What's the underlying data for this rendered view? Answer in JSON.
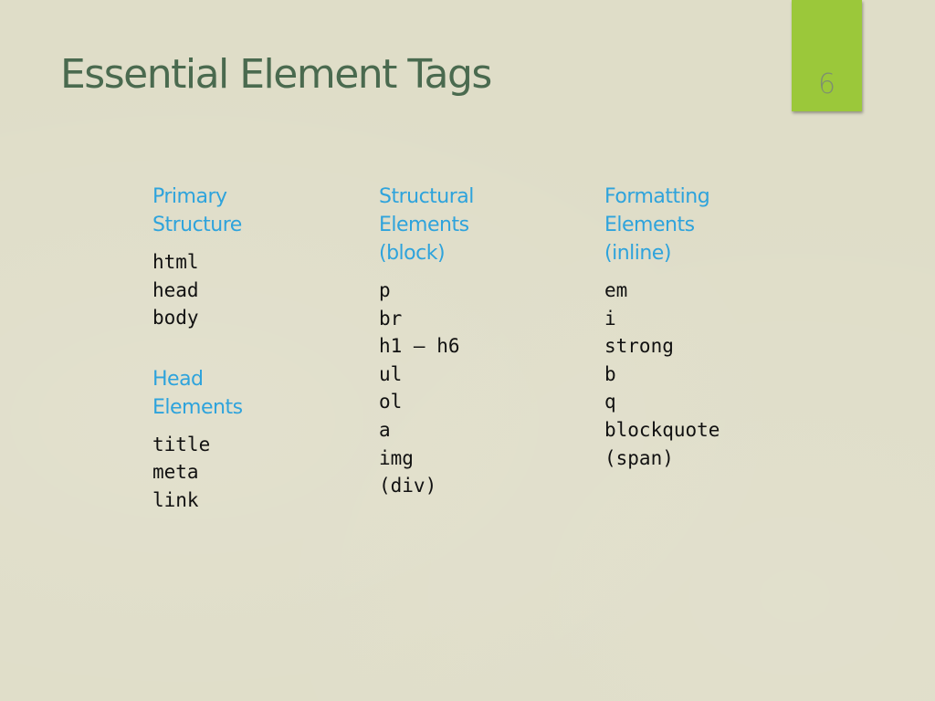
{
  "slide": {
    "title": "Essential Element Tags",
    "page_number": "6",
    "colors": {
      "background": "#dfddc8",
      "title": "#4a6a4f",
      "accent_tab": "#9bc83a",
      "heading": "#2ea3dc",
      "body_text": "#111111"
    }
  },
  "columns": [
    {
      "sections": [
        {
          "heading_lines": [
            "Primary",
            "Structure"
          ],
          "tags": [
            "html",
            "head",
            "body"
          ]
        },
        {
          "heading_lines": [
            "Head",
            "Elements"
          ],
          "tags": [
            "title",
            "meta",
            "link"
          ]
        }
      ]
    },
    {
      "sections": [
        {
          "heading_lines": [
            "Structural",
            "Elements",
            "(block)"
          ],
          "tags": [
            "p",
            "br",
            "h1 – h6",
            "ul",
            "ol",
            "a",
            "img",
            "(div)"
          ]
        }
      ]
    },
    {
      "sections": [
        {
          "heading_lines": [
            "Formatting",
            "Elements",
            "(inline)"
          ],
          "tags": [
            "em",
            "i",
            "strong",
            "b",
            "q",
            "blockquote",
            "(span)"
          ]
        }
      ]
    }
  ]
}
